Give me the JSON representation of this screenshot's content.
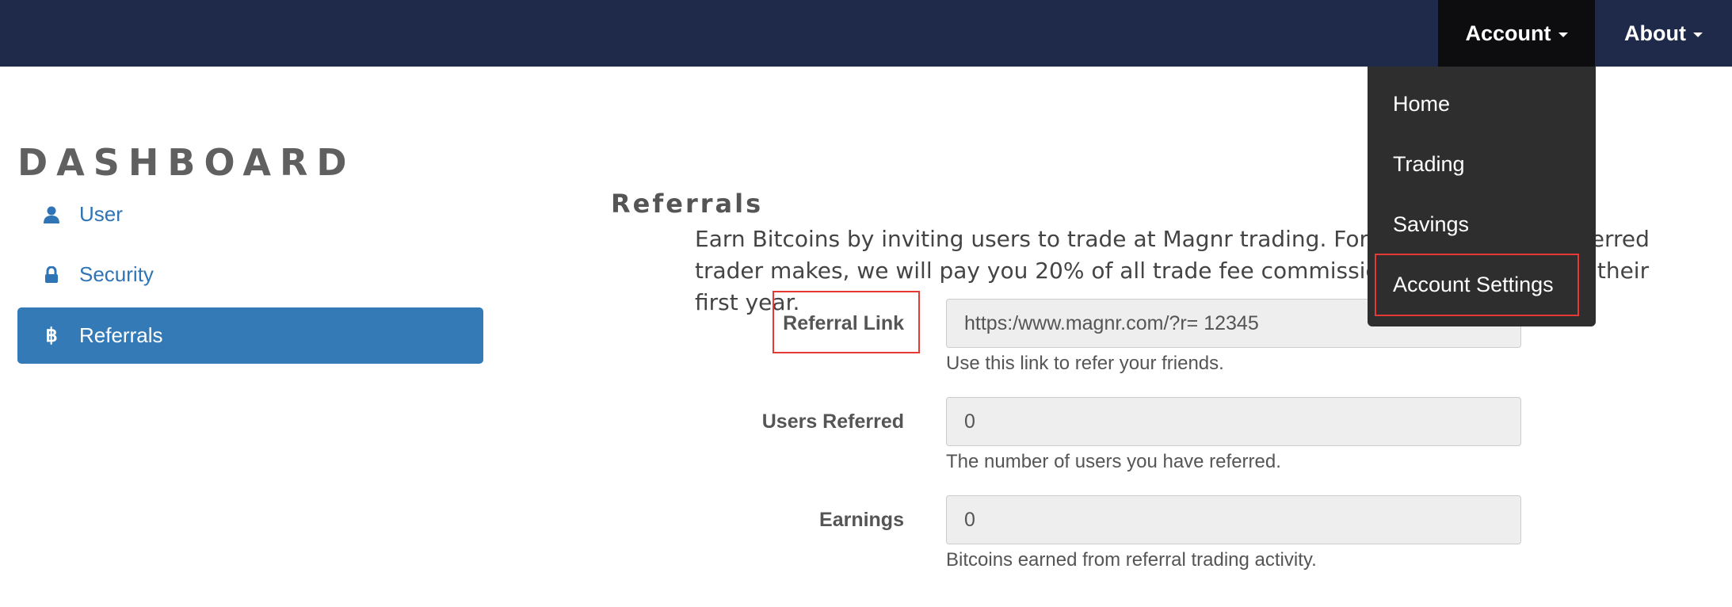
{
  "navbar": {
    "account_label": "Account",
    "about_label": "About",
    "bg_color": "#1f2a4a"
  },
  "dropdown": {
    "items": [
      {
        "label": "Home"
      },
      {
        "label": "Trading"
      },
      {
        "label": "Savings"
      },
      {
        "label": "Account Settings"
      }
    ]
  },
  "sidebar": {
    "title": "DASHBOARD",
    "items": [
      {
        "label": "User",
        "icon": "user-icon"
      },
      {
        "label": "Security",
        "icon": "lock-icon"
      },
      {
        "label": "Referrals",
        "icon": "bitcoin-icon",
        "active": true
      }
    ],
    "active_color": "#337ab7"
  },
  "main": {
    "section_title": "Referrals",
    "intro": "Earn Bitcoins by inviting users to trade at Magnr trading. For every position a referred trader makes, we will pay you 20% of all trade fee commissions we make during their first year.",
    "fields": [
      {
        "label": "Referral Link",
        "value": "https:/www.magnr.com/?r= 12345",
        "help": "Use this link to refer your friends."
      },
      {
        "label": "Users Referred",
        "value": "0",
        "help": "The number of users you have referred."
      },
      {
        "label": "Earnings",
        "value": "0",
        "help": "Bitcoins earned from referral trading activity."
      }
    ]
  },
  "highlight_color": "#e53935"
}
